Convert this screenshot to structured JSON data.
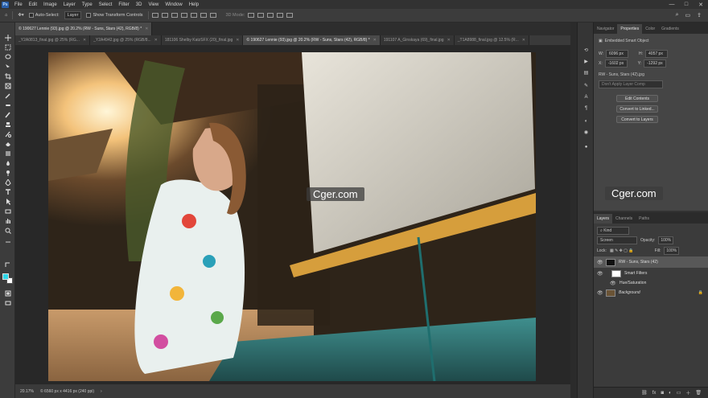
{
  "menubar": {
    "logo": "Ps",
    "items": [
      "File",
      "Edit",
      "Image",
      "Layer",
      "Type",
      "Select",
      "Filter",
      "3D",
      "View",
      "Window",
      "Help"
    ],
    "window_controls": [
      "—",
      "□",
      "✕"
    ]
  },
  "options_bar": {
    "auto_select_label": "Auto-Select:",
    "auto_select_value": "Layer",
    "show_transform_label": "Show Transform Controls",
    "mode_3d_label": "3D Mode:"
  },
  "tabs_row1": [
    {
      "label": "© 190627 Lennie (93).jpg @ 20.2% (RW - Suns, Stars (42), RGB/8) *",
      "active": true
    }
  ],
  "tabs_row2": [
    {
      "label": "_Y2A0813_final.jpg @ 25% (RG...",
      "active": false
    },
    {
      "label": "_Y2A4942.jpg @ 25% (RGB/8...",
      "active": false
    },
    {
      "label": "181106 Shelby KatzSFX (20)_final.jpg",
      "active": false
    },
    {
      "label": "© 190627 Lennie (93).jpg @ 20.2% (RW - Suns, Stars (42), RGB/8) *",
      "active": true
    },
    {
      "label": "191107 A_Ginskaya (69)_final.jpg",
      "active": false
    },
    {
      "label": "_T1A8988_final.jpg @ 12.5% (R...",
      "active": false
    }
  ],
  "status_bar": {
    "zoom": "20.17%",
    "doc_info": "© 6560 px x 4416 px (240 ppi)"
  },
  "watermarks": [
    "Cger.com",
    "Cger.com"
  ],
  "panel_tabs_top": [
    "Navigator",
    "Properties",
    "Color",
    "Gradients"
  ],
  "properties": {
    "type_label": "Embedded Smart Object",
    "w_label": "W:",
    "w_value": "6096 px",
    "h_label": "H:",
    "h_value": "4057 px",
    "x_label": "X:",
    "x_value": "-1602 px",
    "y_label": "Y:",
    "y_value": "-1292 px",
    "file_name": "RW - Suns, Stars (42).jpg",
    "layer_comp_placeholder": "Don't Apply Layer Comp",
    "buttons": [
      "Edit Contents",
      "Convert to Linked...",
      "Convert to Layers"
    ]
  },
  "layers_panel": {
    "tabs": [
      "Layers",
      "Channels",
      "Paths"
    ],
    "kind_label": "Kind",
    "blend_mode": "Screen",
    "opacity_label": "Opacity:",
    "opacity_value": "100%",
    "lock_label": "Lock:",
    "fill_label": "Fill:",
    "fill_value": "100%",
    "layers": [
      {
        "name": "RW - Suns, Stars (42)",
        "selected": true
      },
      {
        "name": "Smart Filters",
        "selected": false
      },
      {
        "name": "Hue/Saturation",
        "selected": false
      },
      {
        "name": "Background",
        "selected": false
      }
    ]
  },
  "colors": {
    "foreground": "#2fd6e8",
    "background": "#ffffff",
    "accent": "#2a5ea8"
  }
}
